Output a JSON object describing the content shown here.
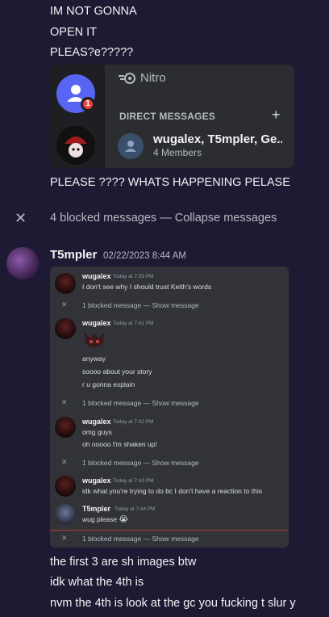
{
  "top_messages": [
    "IM NOT GONNA",
    "OPEN IT",
    "PLEAS?e?????"
  ],
  "embed1": {
    "nitro_label": "Nitro",
    "badge_count": "1",
    "dm_header": "DIRECT MESSAGES",
    "plus": "+",
    "dm_name": "wugalex, T5mpler, Ge...",
    "dm_members": "4 Members"
  },
  "after_embed_message": "PLEASE ???? WHATS HAPPENING PELASE",
  "blocked_bar": {
    "text": "4 blocked messages — ",
    "link": "Collapse messages"
  },
  "main_message": {
    "author": "T5mpler",
    "timestamp": "02/22/2023 8:44 AM"
  },
  "embed2": {
    "msg1": {
      "name": "wugalex",
      "time": "Today at 7:39 PM",
      "text": "I don't see why I should trust Keith's words"
    },
    "blocked1": "1 blocked message — Show message",
    "msg2": {
      "name": "wugalex",
      "time": "Today at 7:41 PM",
      "lines": [
        "anyway",
        "soooo about your story",
        "r u gonna explain"
      ]
    },
    "blocked2": "1 blocked message — Show message",
    "msg3": {
      "name": "wugalex",
      "time": "Today at 7:42 PM",
      "lines": [
        "omg guys",
        "oh noooo I'm shaken up!"
      ]
    },
    "blocked3": "1 blocked message — Show message",
    "msg4": {
      "name": "wugalex",
      "time": "Today at 7:43 PM",
      "text": "idk what you're trying to do bc I don't have a reaction to this"
    },
    "msg5": {
      "name": "T5mpler",
      "time": "Today at 7:44 PM",
      "text": "wug please",
      "emoji": "😭"
    },
    "blocked4": "1 blocked message — Show message"
  },
  "bottom_messages": [
    "the first 3 are sh images btw",
    "idk what the 4th is",
    "nvm the 4th is look at the gc you fucking t slur y"
  ],
  "colors": {
    "background": "#1e1a33",
    "blurple": "#5865f2",
    "danger": "#f23f43"
  }
}
